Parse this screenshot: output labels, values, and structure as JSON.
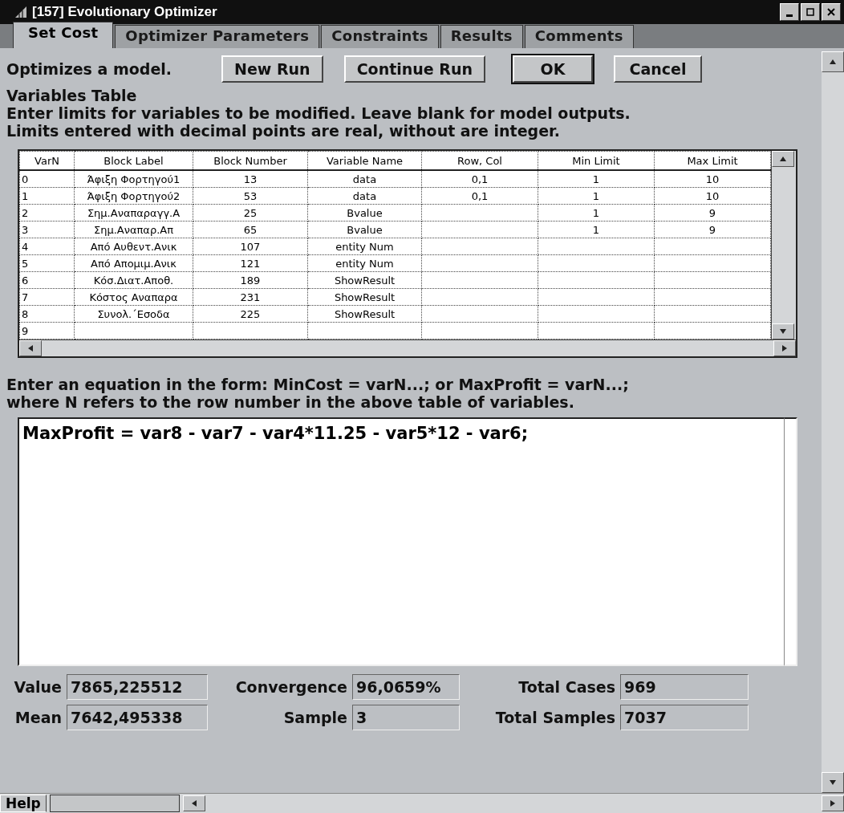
{
  "window": {
    "title": "[157]  Evolutionary Optimizer"
  },
  "tabs": [
    {
      "label": "Set Cost",
      "selected": true
    },
    {
      "label": "Optimizer Parameters",
      "selected": false
    },
    {
      "label": "Constraints",
      "selected": false
    },
    {
      "label": "Results",
      "selected": false
    },
    {
      "label": "Comments",
      "selected": false
    }
  ],
  "description": "Optimizes a model.",
  "buttons": [
    {
      "label": "New Run",
      "default": false
    },
    {
      "label": "Continue Run",
      "default": false
    },
    {
      "label": "OK",
      "default": true
    },
    {
      "label": "Cancel",
      "default": false
    }
  ],
  "variables_table": {
    "title": "Variables Table",
    "instructions": [
      "Enter limits for variables to be modified. Leave blank for model outputs.",
      "Limits entered with decimal points are real, without are integer."
    ],
    "columns": [
      "VarN",
      "Block Label",
      "Block Number",
      "Variable Name",
      "Row, Col",
      "Min Limit",
      "Max Limit"
    ],
    "rows": [
      {
        "varn": "0",
        "block_label": "Άφιξη Φορτηγού1",
        "block_number": "13",
        "variable_name": "data",
        "row_col": "0,1",
        "min_limit": "1",
        "max_limit": "10"
      },
      {
        "varn": "1",
        "block_label": "Άφιξη Φορτηγού2",
        "block_number": "53",
        "variable_name": "data",
        "row_col": "0,1",
        "min_limit": "1",
        "max_limit": "10"
      },
      {
        "varn": "2",
        "block_label": "Σημ.Αναπαραγγ.Α",
        "block_number": "25",
        "variable_name": "Bvalue",
        "min_limit": "1",
        "max_limit": "9"
      },
      {
        "varn": "3",
        "block_label": "Σημ.Αναπαρ.Απ",
        "block_number": "65",
        "variable_name": "Bvalue",
        "min_limit": "1",
        "max_limit": "9"
      },
      {
        "varn": "4",
        "block_label": "Από Αυθεντ.Ανικ",
        "block_number": "107",
        "variable_name": "entity Num"
      },
      {
        "varn": "5",
        "block_label": "Από Απομιμ.Ανικ",
        "block_number": "121",
        "variable_name": "entity Num"
      },
      {
        "varn": "6",
        "block_label": "Κόσ.Διατ.Αποθ.",
        "block_number": "189",
        "variable_name": "ShowResult"
      },
      {
        "varn": "7",
        "block_label": "Κόστος Αναπαρα",
        "block_number": "231",
        "variable_name": "ShowResult"
      },
      {
        "varn": "8",
        "block_label": "Συνολ.΄Εσοδα",
        "block_number": "225",
        "variable_name": "ShowResult"
      },
      {
        "varn": "9"
      }
    ]
  },
  "equation_help": [
    "Enter an equation in the form: MinCost = varN...; or MaxProfit = varN...;",
    "where N refers to the row number in the above table of variables."
  ],
  "equation": {
    "value": "MaxProfit = var8 - var7 - var4*11.25 - var5*12 - var6;"
  },
  "stats": [
    {
      "label": "Value",
      "value": "7865,225512"
    },
    {
      "label": "Convergence",
      "value": "96,0659%"
    },
    {
      "label": "Total Cases",
      "value": "969"
    },
    {
      "label": "Mean",
      "value": "7642,495338"
    },
    {
      "label": "Sample",
      "value": "3"
    },
    {
      "label": "Total Samples",
      "value": "7037"
    }
  ],
  "help": {
    "label": "Help"
  }
}
